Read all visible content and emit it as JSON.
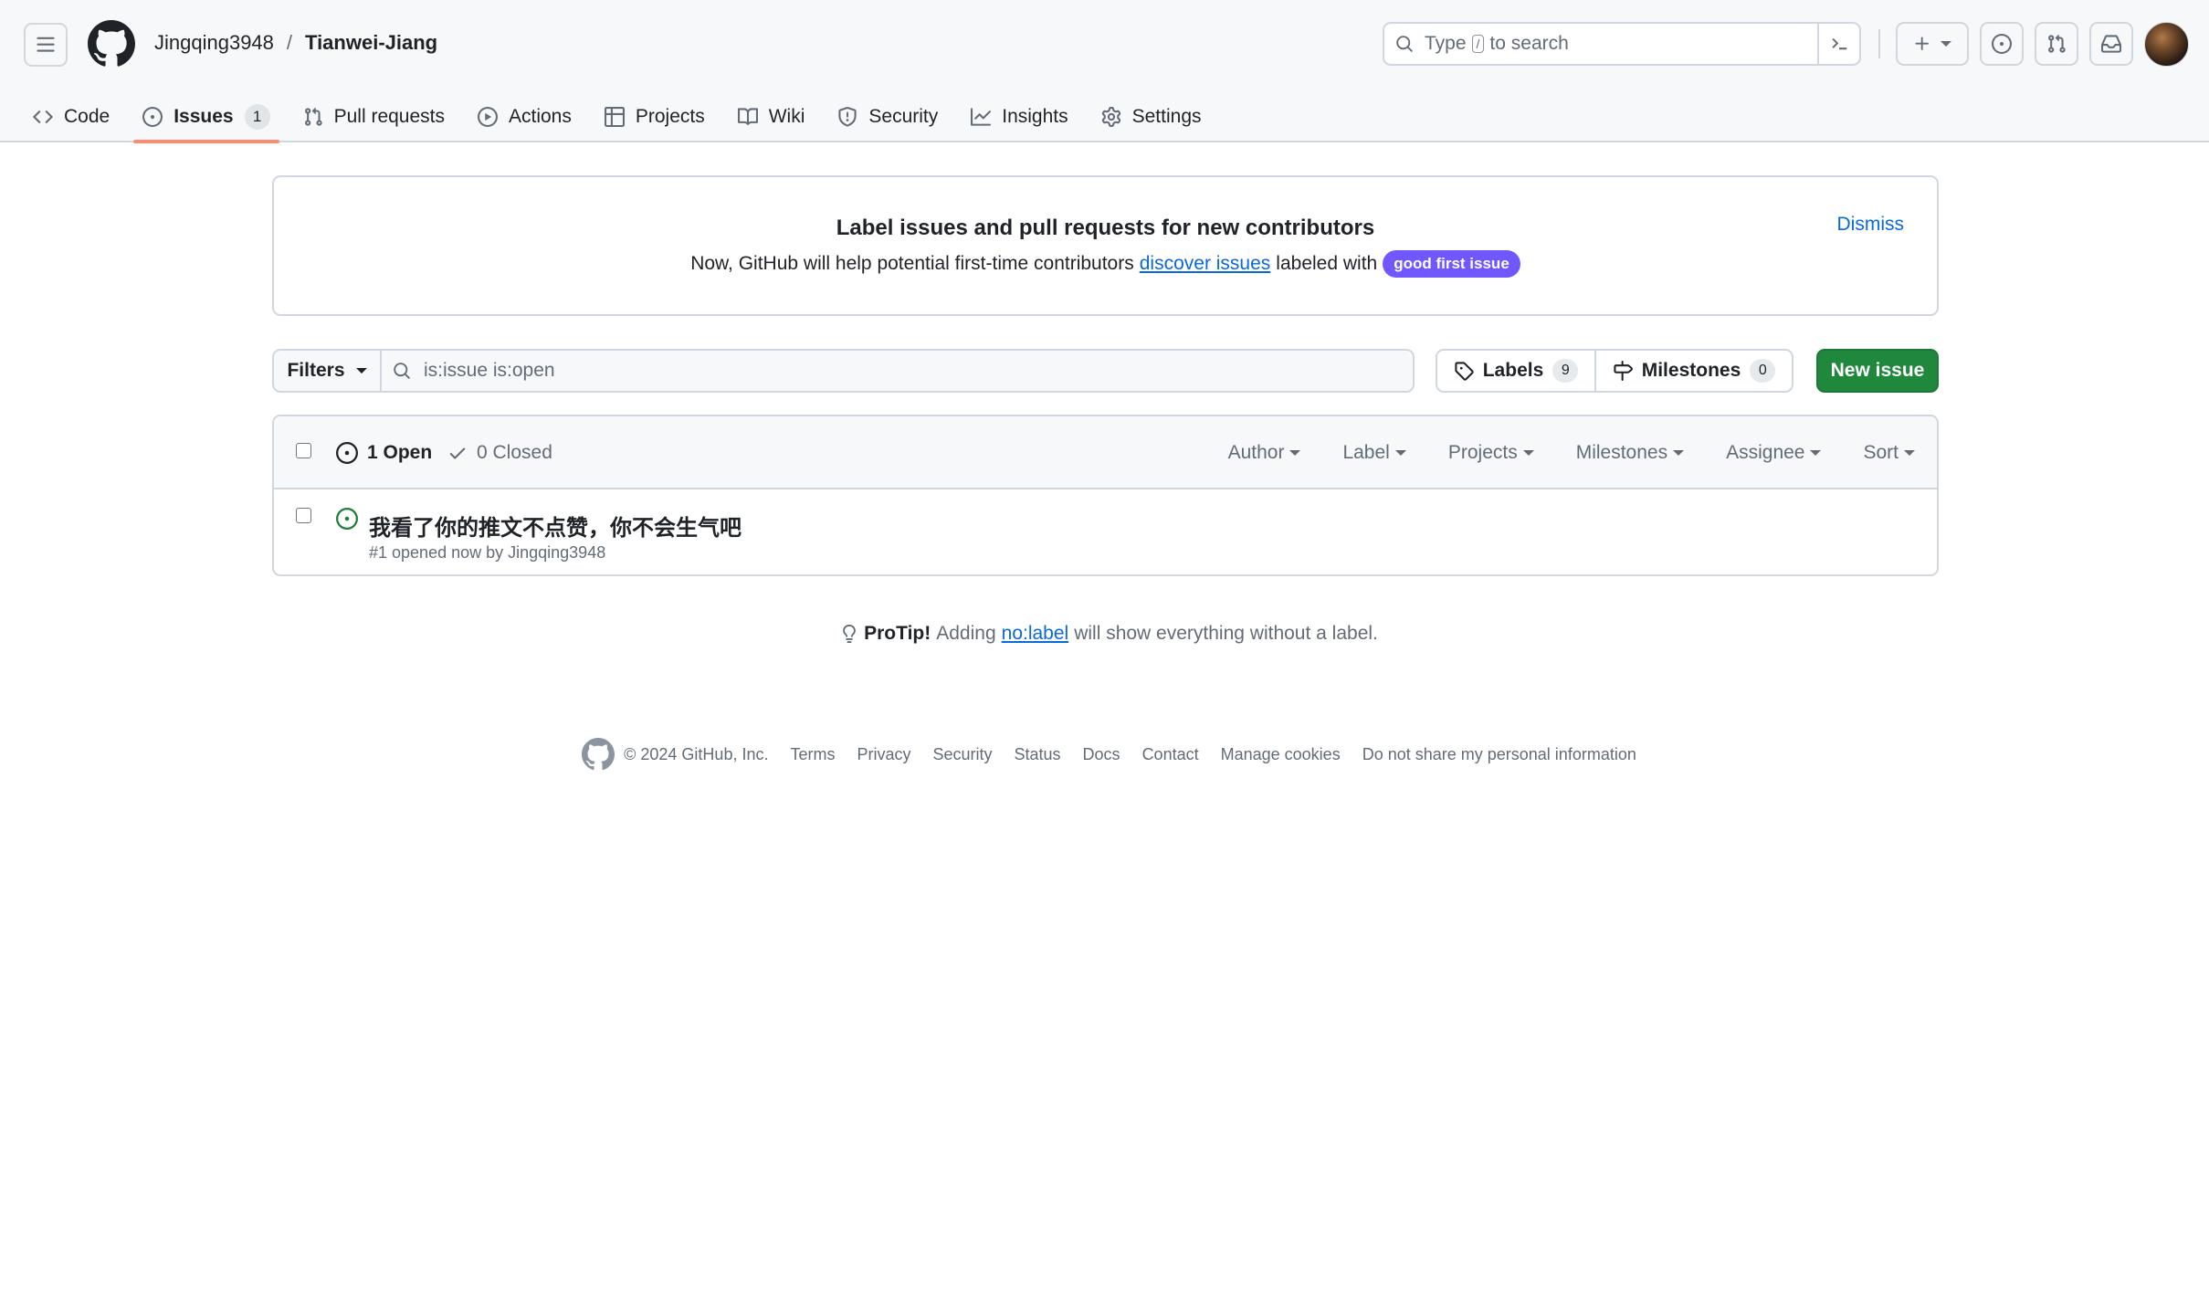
{
  "header": {
    "owner": "Jingqing3948",
    "separator": "/",
    "repo": "Tianwei-Jiang",
    "search": {
      "pre": "Type",
      "key": "/",
      "post": "to search"
    }
  },
  "tabs": [
    {
      "label": "Code",
      "icon": "code-icon"
    },
    {
      "label": "Issues",
      "icon": "issue-opened-icon",
      "count": "1",
      "selected": true
    },
    {
      "label": "Pull requests",
      "icon": "git-pull-request-icon"
    },
    {
      "label": "Actions",
      "icon": "play-icon"
    },
    {
      "label": "Projects",
      "icon": "table-icon"
    },
    {
      "label": "Wiki",
      "icon": "book-icon"
    },
    {
      "label": "Security",
      "icon": "shield-icon"
    },
    {
      "label": "Insights",
      "icon": "graph-icon"
    },
    {
      "label": "Settings",
      "icon": "gear-icon"
    }
  ],
  "banner": {
    "title": "Label issues and pull requests for new contributors",
    "body_pre": "Now, GitHub will help potential first-time contributors",
    "link": "discover issues",
    "body_post": "labeled with",
    "label": "good first issue",
    "label_color": "#7057ff",
    "dismiss": "Dismiss"
  },
  "filterbar": {
    "filters": "Filters",
    "query": "is:issue is:open",
    "labels": "Labels",
    "labels_count": "9",
    "milestones": "Milestones",
    "milestones_count": "0",
    "new_issue": "New issue",
    "new_issue_color": "#1f883d"
  },
  "list": {
    "open": "1 Open",
    "closed": "0 Closed",
    "sorts": [
      "Author",
      "Label",
      "Projects",
      "Milestones",
      "Assignee",
      "Sort"
    ],
    "issues": [
      {
        "title": "我看了你的推文不点赞，你不会生气吧",
        "meta": "#1 opened now by Jingqing3948",
        "state_color": "#1a7f37"
      }
    ]
  },
  "protip": {
    "strong": "ProTip!",
    "pre": "Adding",
    "link": "no:label",
    "post": "will show everything without a label."
  },
  "footer": {
    "copyright": "© 2024 GitHub, Inc.",
    "links": [
      "Terms",
      "Privacy",
      "Security",
      "Status",
      "Docs",
      "Contact",
      "Manage cookies",
      "Do not share my personal information"
    ]
  }
}
